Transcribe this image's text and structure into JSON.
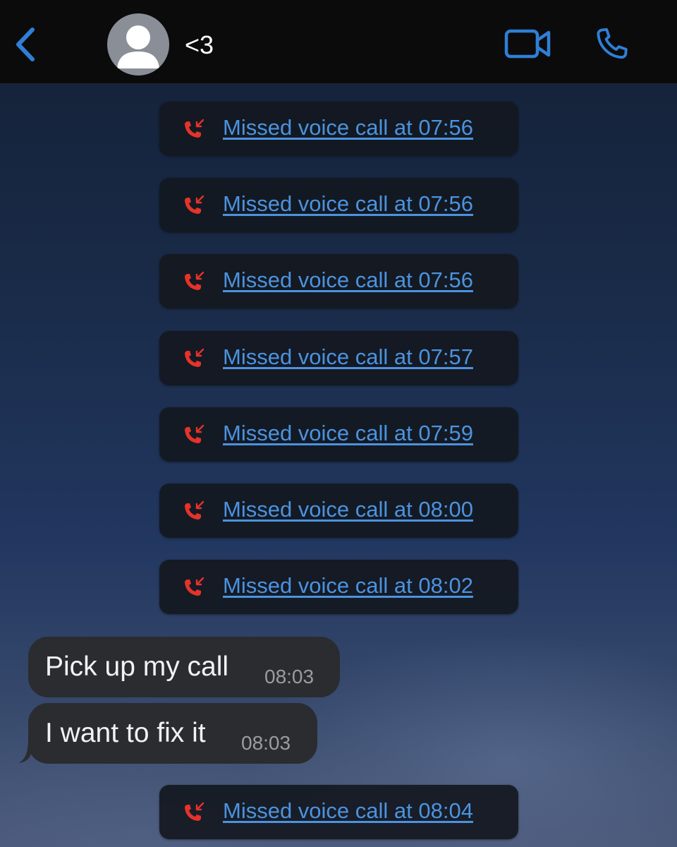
{
  "header": {
    "contact_name": "<3",
    "back_icon": "chevron-left-icon",
    "avatar_icon": "person-icon",
    "video_icon": "video-camera-icon",
    "phone_icon": "phone-icon"
  },
  "colors": {
    "accent": "#2f7fd6",
    "missed_call_red": "#e5332a",
    "link_text": "#4b93e0",
    "received_bubble": "#2b2c30"
  },
  "missed_calls_before": [
    {
      "label": "Missed voice call at 07:56"
    },
    {
      "label": "Missed voice call at 07:56"
    },
    {
      "label": "Missed voice call at 07:56"
    },
    {
      "label": "Missed voice call at 07:57"
    },
    {
      "label": "Missed voice call at 07:59"
    },
    {
      "label": "Missed voice call at 08:00"
    },
    {
      "label": "Missed voice call at 08:02"
    }
  ],
  "messages": [
    {
      "text": "Pick up my call",
      "time": "08:03"
    },
    {
      "text": "I want to fix it",
      "time": "08:03"
    }
  ],
  "missed_calls_after": [
    {
      "label": "Missed voice call at 08:04"
    }
  ]
}
